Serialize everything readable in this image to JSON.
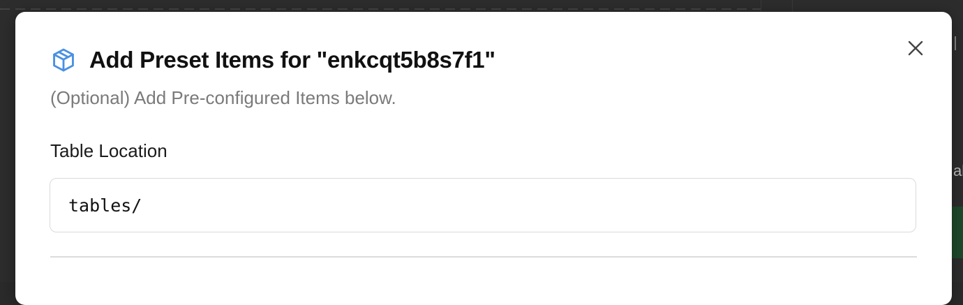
{
  "modal": {
    "title": "Add Preset Items for \"enkcqt5b8s7f1\"",
    "subtitle": "(Optional) Add Pre-configured Items below.",
    "header_icon": "package-box-icon",
    "close_icon": "close-icon",
    "accent_color": "#4a90e2"
  },
  "form": {
    "table_location": {
      "label": "Table Location",
      "value": "tables/"
    }
  },
  "background": {
    "right_edge_text": "ab"
  }
}
